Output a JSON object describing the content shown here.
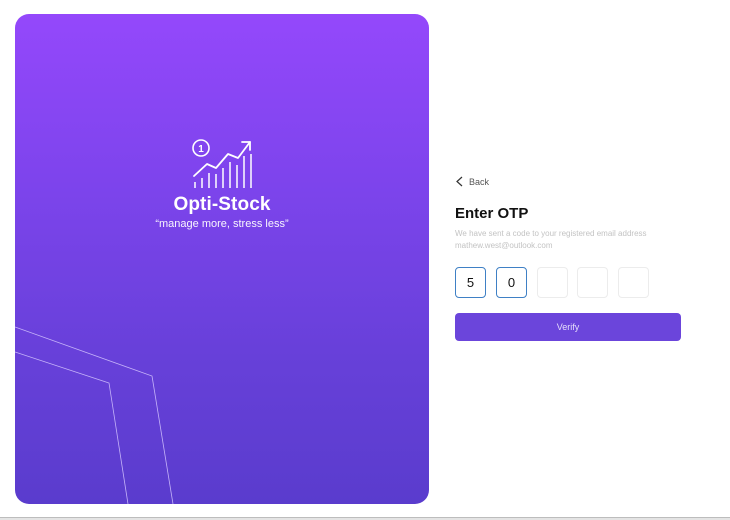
{
  "brand": {
    "name": "Opti-Stock",
    "tagline": "“manage more, stress less”",
    "logo_icon": "growth-chart-icon",
    "logo_badge_number": "1"
  },
  "colors": {
    "gradient_top": "#9448fb",
    "gradient_bottom": "#5a3ccd",
    "accent": "#6b45db",
    "otp_focus_border": "#3f80c5"
  },
  "back": {
    "label": "Back",
    "icon": "chevron-left-icon"
  },
  "otp": {
    "title": "Enter OTP",
    "subtitle_line1": "We have sent a code to your registered email address",
    "email": "mathew.west@outlook.com",
    "digits": [
      "5",
      "0",
      "",
      "",
      ""
    ],
    "verify_label": "Verify"
  }
}
